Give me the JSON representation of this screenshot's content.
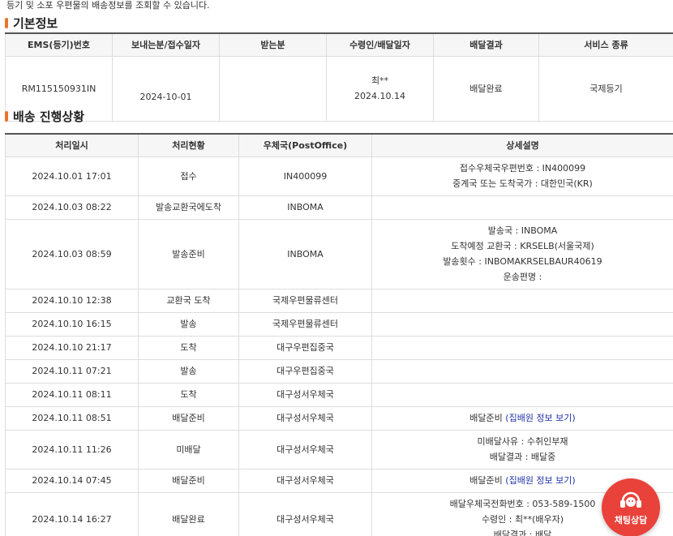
{
  "intro_text": "등기 및 소포 우편물의 배송정보를 조회할 수 있습니다.",
  "basic": {
    "title": "기본정보",
    "headers": [
      "EMS(등기)번호",
      "보내는분/접수일자",
      "받는분",
      "수령인/배달일자",
      "배달결과",
      "서비스 종류"
    ],
    "tracking_no": "RM115150931IN",
    "sender_date": "2024-10-01",
    "receiver": "",
    "recipient_name": "최**",
    "recipient_date": "2024.10.14",
    "result": "배달완료",
    "service": "국제등기"
  },
  "progress": {
    "title": "배송 진행상황",
    "headers": [
      "처리일시",
      "처리현황",
      "우체국(PostOffice)",
      "상세설명"
    ],
    "rows": [
      {
        "datetime": "2024.10.01 17:01",
        "status": "접수",
        "office": "IN400099",
        "detail": [
          "접수우체국우편번호 : IN400099",
          "중계국 또는 도착국가 : 대한민국(KR)"
        ]
      },
      {
        "datetime": "2024.10.03 08:22",
        "status": "발송교환국에도착",
        "office": "INBOMA",
        "detail": []
      },
      {
        "datetime": "2024.10.03 08:59",
        "status": "발송준비",
        "office": "INBOMA",
        "detail": [
          "발송국 : INBOMA",
          "도착예정 교환국 : KRSELB(서울국제)",
          "발송횟수 : INBOMAKRSELBAUR40619",
          "운송편명 :"
        ]
      },
      {
        "datetime": "2024.10.10 12:38",
        "status": "교환국 도착",
        "office": "국제우편물류센터",
        "detail": []
      },
      {
        "datetime": "2024.10.10 16:15",
        "status": "발송",
        "office": "국제우편물류센터",
        "detail": []
      },
      {
        "datetime": "2024.10.10 21:17",
        "status": "도착",
        "office": "대구우편집중국",
        "detail": []
      },
      {
        "datetime": "2024.10.11 07:21",
        "status": "발송",
        "office": "대구우편집중국",
        "detail": []
      },
      {
        "datetime": "2024.10.11 08:11",
        "status": "도착",
        "office": "대구성서우체국",
        "detail": []
      },
      {
        "datetime": "2024.10.11 08:51",
        "status": "배달준비",
        "office": "대구성서우체국",
        "detail": [
          "배달준비"
        ],
        "link": "(집배원 정보 보기)"
      },
      {
        "datetime": "2024.10.11 11:26",
        "status": "미배달",
        "office": "대구성서우체국",
        "detail": [
          "미배달사유 : 수취인부재",
          "배달결과 : 배달중"
        ]
      },
      {
        "datetime": "2024.10.14 07:45",
        "status": "배달준비",
        "office": "대구성서우체국",
        "detail": [
          "배달준비"
        ],
        "link": "(집배원 정보 보기)"
      },
      {
        "datetime": "2024.10.14 16:27",
        "status": "배달완료",
        "office": "대구성서우체국",
        "detail": [
          "배달우체국전화번호 : 053-589-1500",
          "수령인 : 최**(배우자)",
          "배달결과 : 배달"
        ]
      }
    ]
  },
  "chat_button": {
    "label": "채팅상담",
    "color": "#e8423a"
  },
  "colors": {
    "accent": "#e8742d",
    "link": "#2233aa"
  }
}
